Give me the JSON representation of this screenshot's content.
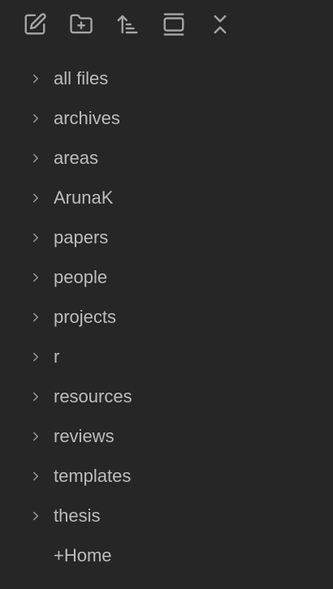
{
  "toolbar": {
    "buttons": [
      {
        "icon": "new-note-icon"
      },
      {
        "icon": "new-folder-icon"
      },
      {
        "icon": "sort-icon"
      },
      {
        "icon": "auto-reveal-icon"
      },
      {
        "icon": "collapse-all-icon"
      }
    ],
    "icon_color": "#a6a6a6"
  },
  "tree": {
    "folders": [
      {
        "label": "all files"
      },
      {
        "label": "archives"
      },
      {
        "label": "areas"
      },
      {
        "label": "ArunaK"
      },
      {
        "label": "papers"
      },
      {
        "label": "people"
      },
      {
        "label": "projects"
      },
      {
        "label": "r"
      },
      {
        "label": "resources"
      },
      {
        "label": "reviews"
      },
      {
        "label": "templates"
      },
      {
        "label": "thesis"
      }
    ],
    "files": [
      {
        "label": "+Home"
      }
    ]
  },
  "colors": {
    "background": "#262626",
    "text": "#bdbdbd",
    "chevron": "#9a9a9a"
  }
}
